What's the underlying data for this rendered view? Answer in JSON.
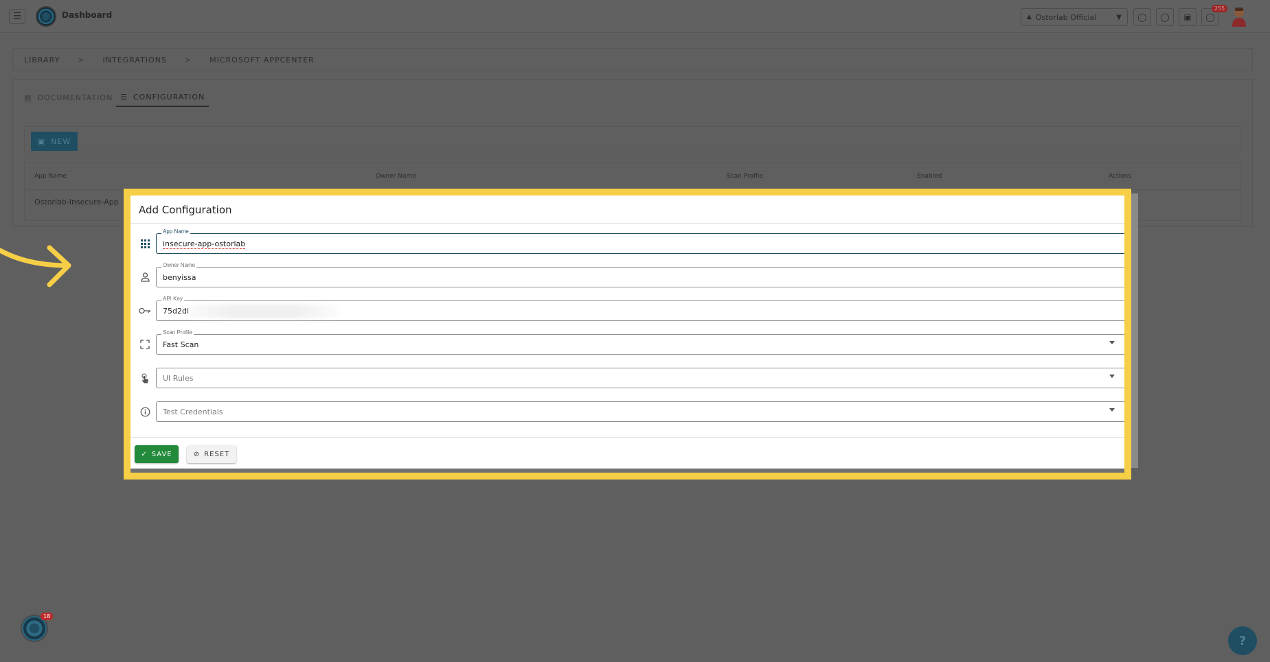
{
  "topbar": {
    "title": "Dashboard",
    "org_name": "Ostorlab Official",
    "notification_count": "255"
  },
  "breadcrumb": [
    "LIBRARY",
    "INTEGRATIONS",
    "MICROSOFT APPCENTER"
  ],
  "breadcrumb_sep": ">",
  "tabs": [
    {
      "label": "DOCUMENTATION"
    },
    {
      "label": "CONFIGURATION"
    }
  ],
  "new_button": "NEW",
  "table": {
    "columns": [
      "App Name",
      "Owner Name",
      "Scan Profile",
      "Enabled",
      "Actions"
    ],
    "rows": [
      {
        "app_name": "Ostorlab-Insecure-App"
      }
    ]
  },
  "modal": {
    "title": "Add Configuration",
    "fields": {
      "app_name": {
        "label": "App Name",
        "value": "insecure-app-ostorlab"
      },
      "owner_name": {
        "label": "Owner Name",
        "value": "benyissa"
      },
      "api_key": {
        "label": "API Key",
        "value": "75d2dl"
      },
      "scan_profile": {
        "label": "Scan Profile",
        "value": "Fast Scan"
      },
      "ui_rules": {
        "placeholder": "UI Rules"
      },
      "test_credentials": {
        "placeholder": "Test Credentials"
      }
    },
    "save_label": "SAVE",
    "reset_label": "RESET"
  },
  "help_badge": "18",
  "fab_label": "?",
  "colors": {
    "highlight": "#f7cf46",
    "primary": "#1f4e63",
    "save": "#238a3b",
    "arrow": "#f7cf46"
  }
}
